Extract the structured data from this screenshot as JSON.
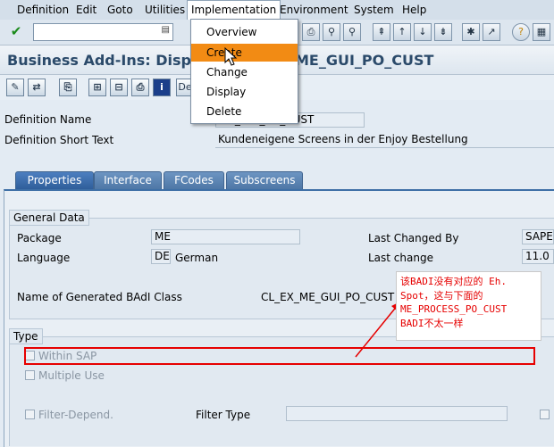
{
  "menubar": {
    "items": [
      "Definition",
      "Edit",
      "Goto",
      "Utilities",
      "Implementation",
      "Environment",
      "System",
      "Help"
    ]
  },
  "title": "Business Add-Ins: Display Definition ME_GUI_PO_CUST",
  "title_visible": "Business Add-Ins: Displ",
  "title_tail": "ME_GUI_PO_CUST",
  "app_toolbar": {
    "truncated_button_label": "De"
  },
  "implementation_menu": {
    "items": [
      "Overview",
      "Create",
      "Change",
      "Display",
      "Delete"
    ],
    "highlighted": "Create",
    "highlight_color": "#f28b14"
  },
  "header_fields": {
    "definition_name_label": "Definition Name",
    "definition_name_value": "ME_GUI_PO_CUST",
    "definition_name_visible": "ME_GUI_PO_CUST",
    "short_text_label": "Definition Short Text",
    "short_text_value": "Kundeneigene Screens in der Enjoy Bestellung"
  },
  "tabs": [
    {
      "label": "Properties",
      "active": true
    },
    {
      "label": "Interface",
      "active": false
    },
    {
      "label": "FCodes",
      "active": false
    },
    {
      "label": "Subscreens",
      "active": false
    }
  ],
  "general_data": {
    "title": "General Data",
    "package_label": "Package",
    "package_value": "ME",
    "language_label": "Language",
    "language_code": "DE",
    "language_name": "German",
    "last_changed_by_label": "Last Changed By",
    "last_changed_by_value": "SAPE",
    "last_change_label": "Last change",
    "last_change_value": "11.0",
    "generated_class_label": "Name of Generated BAdI Class",
    "generated_class_value": "CL_EX_ME_GUI_PO_CUST"
  },
  "type_group": {
    "title": "Type",
    "within_sap_label": "Within SAP",
    "multiple_use_label": "Multiple Use",
    "filter_depend_label": "Filter-Depend.",
    "filter_type_label": "Filter Type",
    "filter_type_value": ""
  },
  "annotation": {
    "text": "该BADI没有对应的 Eh.\nSpot，这与下面的\nME_PROCESS_PO_CUST\nBADI不太一样",
    "color": "#e60000"
  }
}
